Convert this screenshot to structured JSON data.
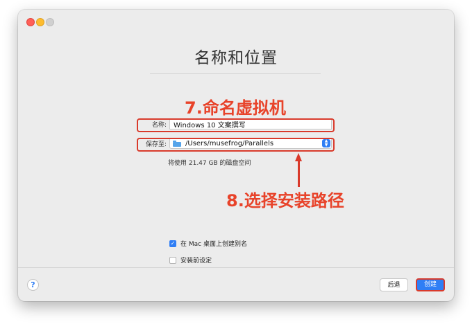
{
  "page_title": "名称和位置",
  "annotations": {
    "step7": "7.命名虚拟机",
    "step8": "8.选择安装路径",
    "color": "#e8432a"
  },
  "form": {
    "name_label": "名称:",
    "name_value": "Windows 10 文案撰写",
    "save_label": "保存至:",
    "save_path": "/Users/musefrog/Parallels",
    "disk_note": "将使用 21.47 GB 的磁盘空间"
  },
  "options": [
    {
      "label": "在 Mac 桌面上创建别名",
      "checked": true
    },
    {
      "label": "安装前设定",
      "checked": false
    }
  ],
  "footer": {
    "help_label": "?",
    "back_label": "后退",
    "create_label": "创建"
  },
  "colors": {
    "accent": "#2f7ef5",
    "highlight": "#d93a2b"
  },
  "icons": {
    "folder": "folder-icon",
    "select": "select-arrows-icon",
    "check": "checkmark-icon"
  }
}
